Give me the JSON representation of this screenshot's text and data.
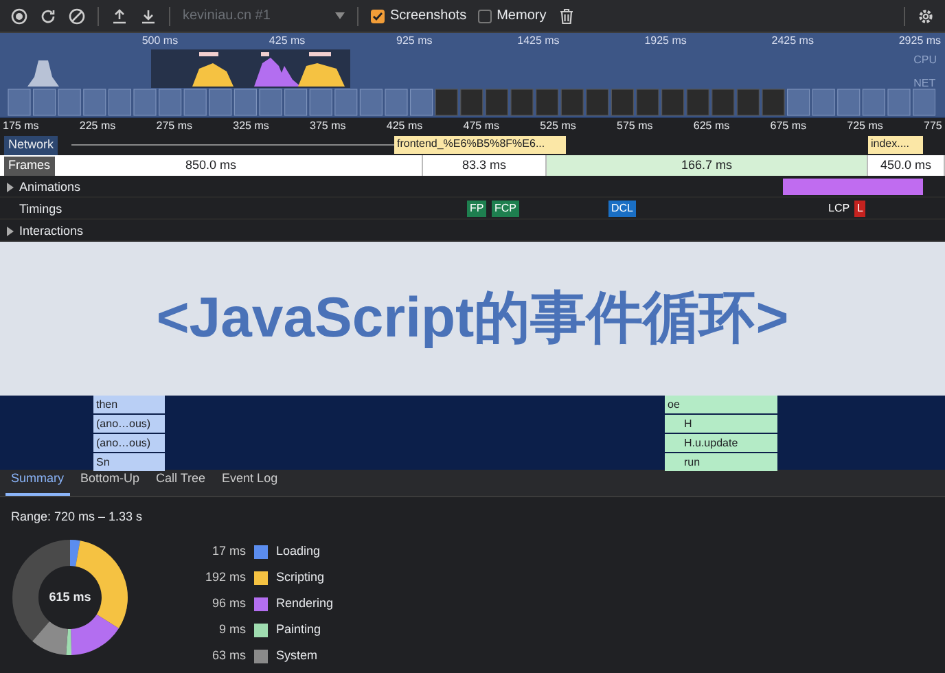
{
  "toolbar": {
    "target": "keviniau.cn #1",
    "checkboxes": [
      {
        "label": "Screenshots",
        "checked": true
      },
      {
        "label": "Memory",
        "checked": false
      }
    ]
  },
  "overview": {
    "ticks": [
      "500 ms",
      "425 ms",
      "925 ms",
      "1425 ms",
      "1925 ms",
      "2425 ms",
      "2925 ms"
    ],
    "lanes": [
      "CPU",
      "NET"
    ]
  },
  "ruler": [
    "175 ms",
    "225 ms",
    "275 ms",
    "325 ms",
    "375 ms",
    "425 ms",
    "475 ms",
    "525 ms",
    "575 ms",
    "625 ms",
    "675 ms",
    "725 ms",
    "775"
  ],
  "network": {
    "label": "Network",
    "requests": [
      "frontend_%E6%B5%8F%E6...",
      "index...."
    ]
  },
  "frames": {
    "label": "Frames",
    "segments": [
      {
        "label": "850.0 ms",
        "kind": "idle"
      },
      {
        "label": "83.3 ms",
        "kind": "idle"
      },
      {
        "label": "166.7 ms",
        "kind": "drawn"
      },
      {
        "label": "450.0 ms",
        "kind": "idle"
      }
    ]
  },
  "tracks": [
    {
      "label": "Animations",
      "expanded": false
    },
    {
      "label": "Timings"
    },
    {
      "label": "Interactions",
      "expanded": false
    }
  ],
  "timings": [
    {
      "label": "FP",
      "color": "#1e7f4f"
    },
    {
      "label": "FCP",
      "color": "#1e7f4f"
    },
    {
      "label": "DCL",
      "color": "#1a6fc4"
    },
    {
      "label": "LCP",
      "color": "#202124"
    },
    {
      "label": "L",
      "color": "#c5221f"
    }
  ],
  "banner": "<JavaScript的事件循环>",
  "flame": {
    "left": [
      "then",
      "(ano…ous)",
      "(ano…ous)",
      "Sn"
    ],
    "right": [
      "oe",
      "H",
      "H.u.update",
      "run"
    ]
  },
  "tabs": [
    {
      "label": "Summary",
      "selected": true
    },
    {
      "label": "Bottom-Up",
      "selected": false
    },
    {
      "label": "Call Tree",
      "selected": false
    },
    {
      "label": "Event Log",
      "selected": false
    }
  ],
  "summary": {
    "range": "Range: 720 ms – 1.33 s",
    "total": "615 ms",
    "legend": [
      {
        "value": "17 ms",
        "label": "Loading",
        "color": "#5b8def"
      },
      {
        "value": "192 ms",
        "label": "Scripting",
        "color": "#f5c242"
      },
      {
        "value": "96 ms",
        "label": "Rendering",
        "color": "#b36ef0"
      },
      {
        "value": "9 ms",
        "label": "Painting",
        "color": "#9fdcb0"
      },
      {
        "value": "63 ms",
        "label": "System",
        "color": "#8a8a8a"
      }
    ]
  }
}
